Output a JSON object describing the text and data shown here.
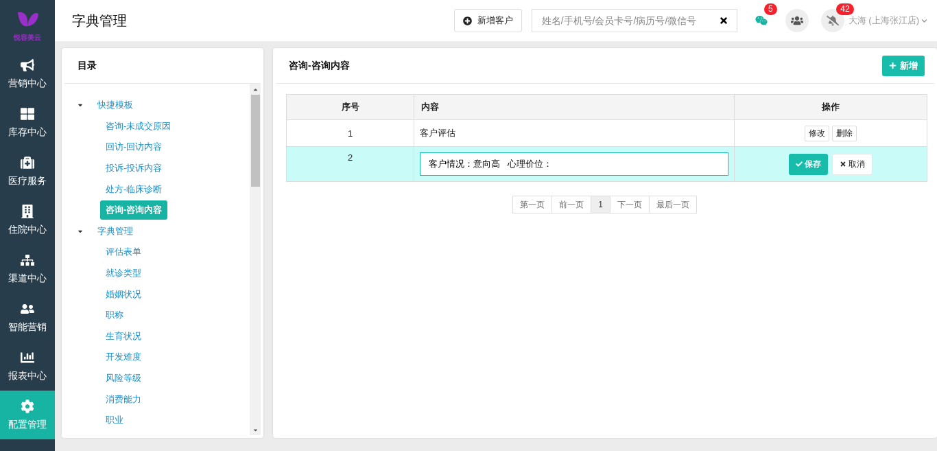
{
  "logo": {
    "text": "悦容美云"
  },
  "sidebar": {
    "items": [
      {
        "label": "营销中心",
        "selected": false
      },
      {
        "label": "库存中心",
        "selected": false
      },
      {
        "label": "医疗服务",
        "selected": false
      },
      {
        "label": "住院中心",
        "selected": false
      },
      {
        "label": "渠道中心",
        "selected": false
      },
      {
        "label": "智能营销",
        "selected": false
      },
      {
        "label": "报表中心",
        "selected": false
      },
      {
        "label": "配置管理",
        "selected": true
      }
    ]
  },
  "header": {
    "title": "字典管理",
    "new_customer": "新增客户",
    "search": {
      "placeholder": "姓名/手机号/会员卡号/病历号/微信号"
    },
    "wechat_badge": "5",
    "bell_badge": "42",
    "user": "大海 (上海张江店)"
  },
  "catalog": {
    "title": "目录",
    "tree": [
      {
        "label": "快捷模板",
        "expanded": true,
        "selected": false,
        "children": [
          {
            "label": "咨询-未成交原因",
            "selected": false
          },
          {
            "label": "回访-回访内容",
            "selected": false
          },
          {
            "label": "投诉-投诉内容",
            "selected": false
          },
          {
            "label": "处方-临床诊断",
            "selected": false
          },
          {
            "label": "咨询-咨询内容",
            "selected": true
          }
        ]
      },
      {
        "label": "字典管理",
        "expanded": true,
        "selected": false,
        "children": [
          {
            "label": "评估表单",
            "selected": false
          },
          {
            "label": "就诊类型",
            "selected": false
          },
          {
            "label": "婚姻状况",
            "selected": false
          },
          {
            "label": "职称",
            "selected": false
          },
          {
            "label": "生育状况",
            "selected": false
          },
          {
            "label": "开发难度",
            "selected": false
          },
          {
            "label": "风险等级",
            "selected": false
          },
          {
            "label": "消费能力",
            "selected": false
          },
          {
            "label": "职业",
            "selected": false
          }
        ]
      }
    ]
  },
  "content": {
    "title": "咨询-咨询内容",
    "add_button": "新增",
    "table": {
      "columns": [
        "序号",
        "内容",
        "操作"
      ],
      "rows": [
        {
          "kind": "view",
          "index": "1",
          "content": "客户评估",
          "actions": [
            "修改",
            "删除"
          ]
        },
        {
          "kind": "edit",
          "index": "2",
          "content": "客户情况：意向高   心理价位：",
          "actions": [
            "保存",
            "取消"
          ]
        }
      ]
    },
    "pagination": [
      {
        "label": "第一页",
        "selected": false
      },
      {
        "label": "前一页",
        "selected": false
      },
      {
        "label": "1",
        "selected": true
      },
      {
        "label": "下一页",
        "selected": false
      },
      {
        "label": "最后一页",
        "selected": false
      }
    ]
  }
}
